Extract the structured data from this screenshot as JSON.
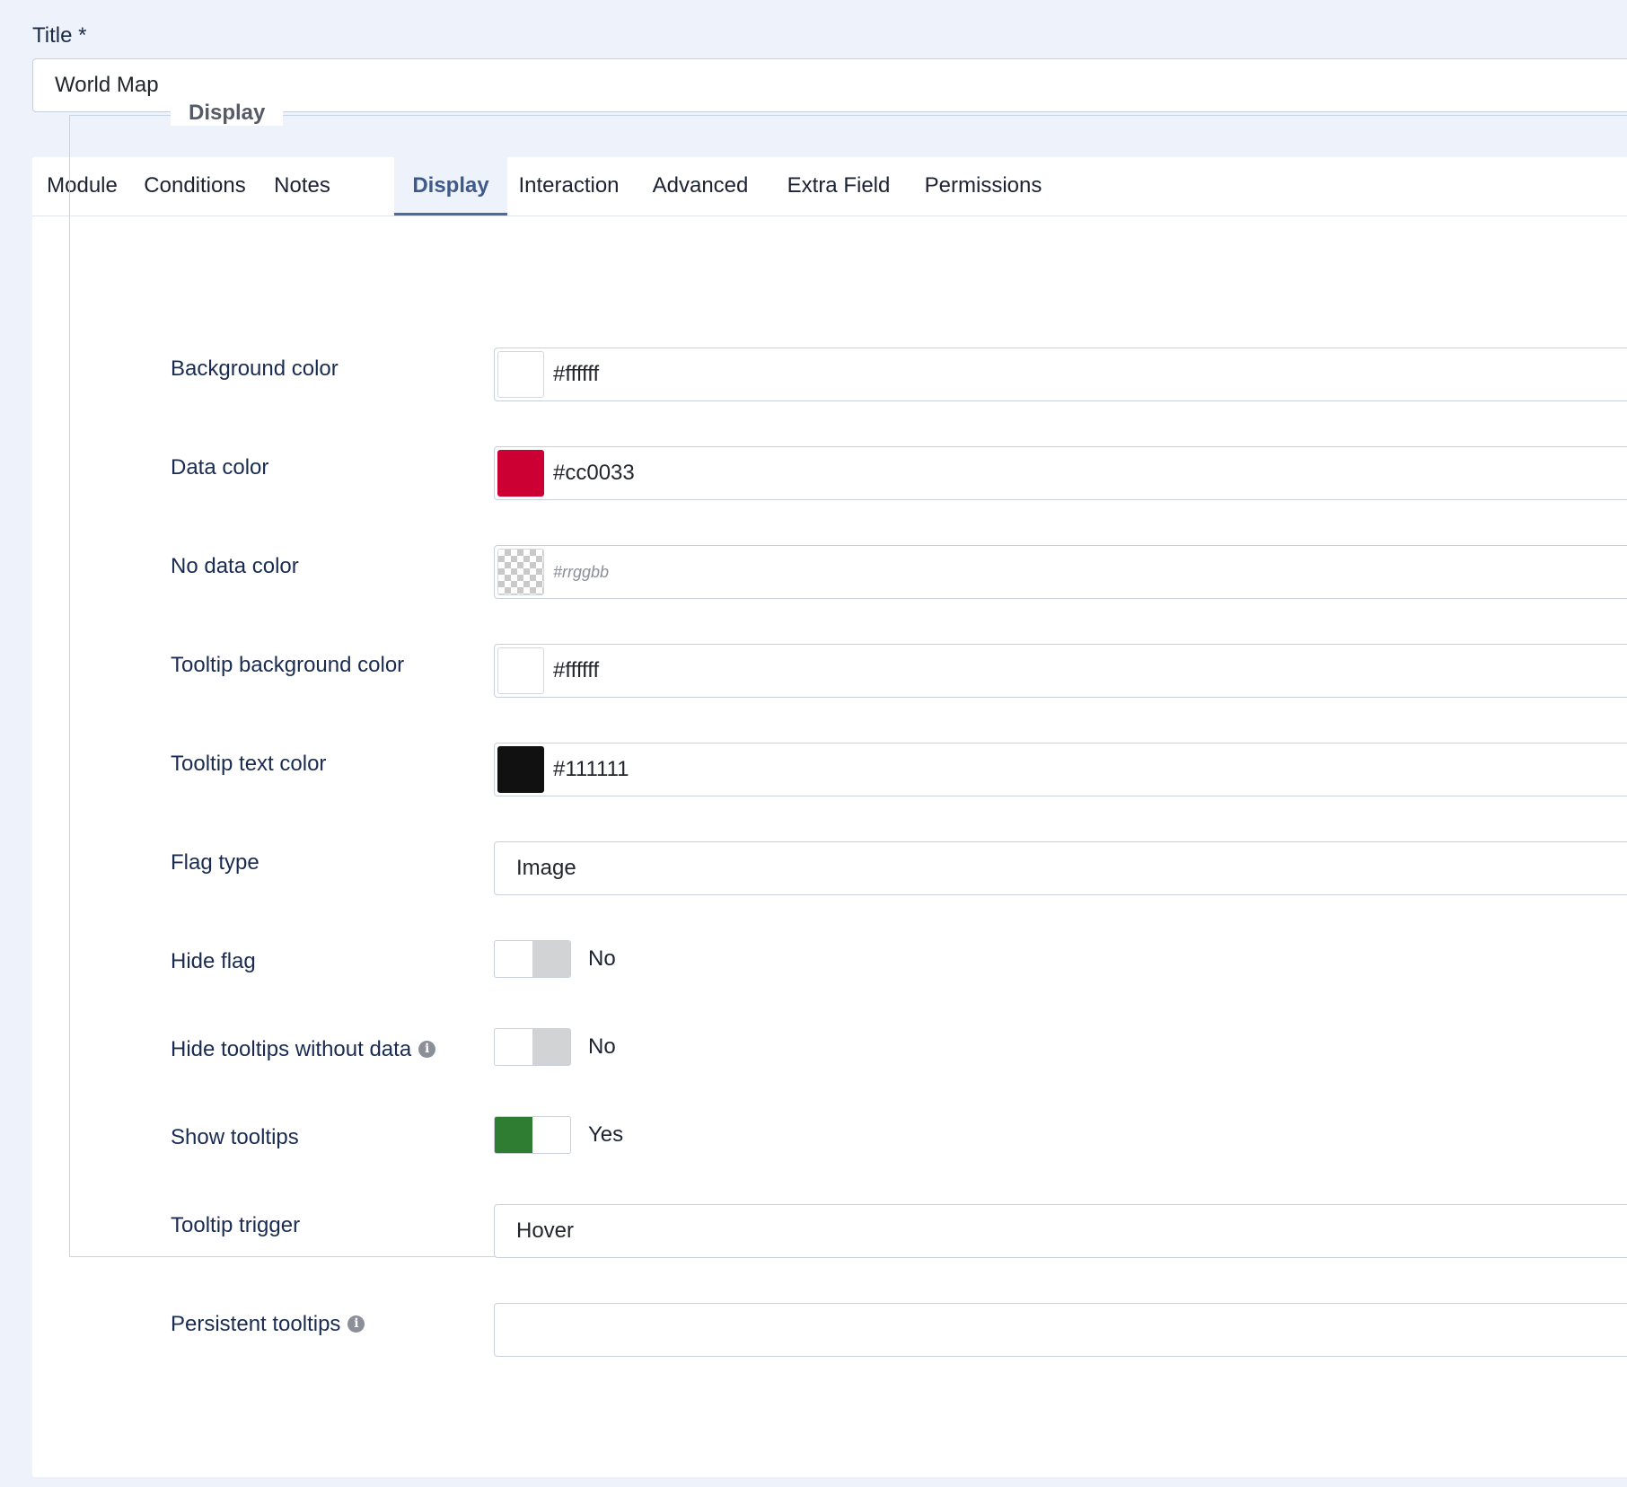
{
  "title": {
    "label": "Title *",
    "value": "World Map"
  },
  "tabs": [
    {
      "label": "Module"
    },
    {
      "label": "Conditions"
    },
    {
      "label": "Notes"
    },
    {
      "label": "Display",
      "active": true
    },
    {
      "label": "Interaction"
    },
    {
      "label": "Advanced"
    },
    {
      "label": "Extra Field"
    },
    {
      "label": "Permissions"
    }
  ],
  "display": {
    "legend": "Display",
    "fields": {
      "background_color": {
        "label": "Background color",
        "value": "#ffffff",
        "swatch": "#ffffff"
      },
      "data_color": {
        "label": "Data color",
        "value": "#cc0033",
        "swatch": "#cc0033"
      },
      "no_data_color": {
        "label": "No data color",
        "placeholder": "#rrggbb"
      },
      "tooltip_bg_color": {
        "label": "Tooltip background color",
        "value": "#ffffff",
        "swatch": "#ffffff"
      },
      "tooltip_text_color": {
        "label": "Tooltip text color",
        "value": "#111111",
        "swatch": "#111111"
      },
      "flag_type": {
        "label": "Flag type",
        "value": "Image"
      },
      "hide_flag": {
        "label": "Hide flag",
        "state": "No",
        "on": false
      },
      "hide_tooltips_without_data": {
        "label": "Hide tooltips without data",
        "state": "No",
        "on": false,
        "info_icon": "info-icon"
      },
      "show_tooltips": {
        "label": "Show tooltips",
        "state": "Yes",
        "on": true
      },
      "tooltip_trigger": {
        "label": "Tooltip trigger",
        "value": "Hover"
      },
      "persistent_tooltips": {
        "label": "Persistent tooltips",
        "value": "",
        "info_icon": "info-icon"
      }
    }
  },
  "colors": {
    "page_background": "#eef3fb",
    "active_tab": "#3d5a8a",
    "toggle_on": "#2e7d32",
    "toggle_off": "#d2d3d5",
    "label_text": "#1a2b52"
  }
}
